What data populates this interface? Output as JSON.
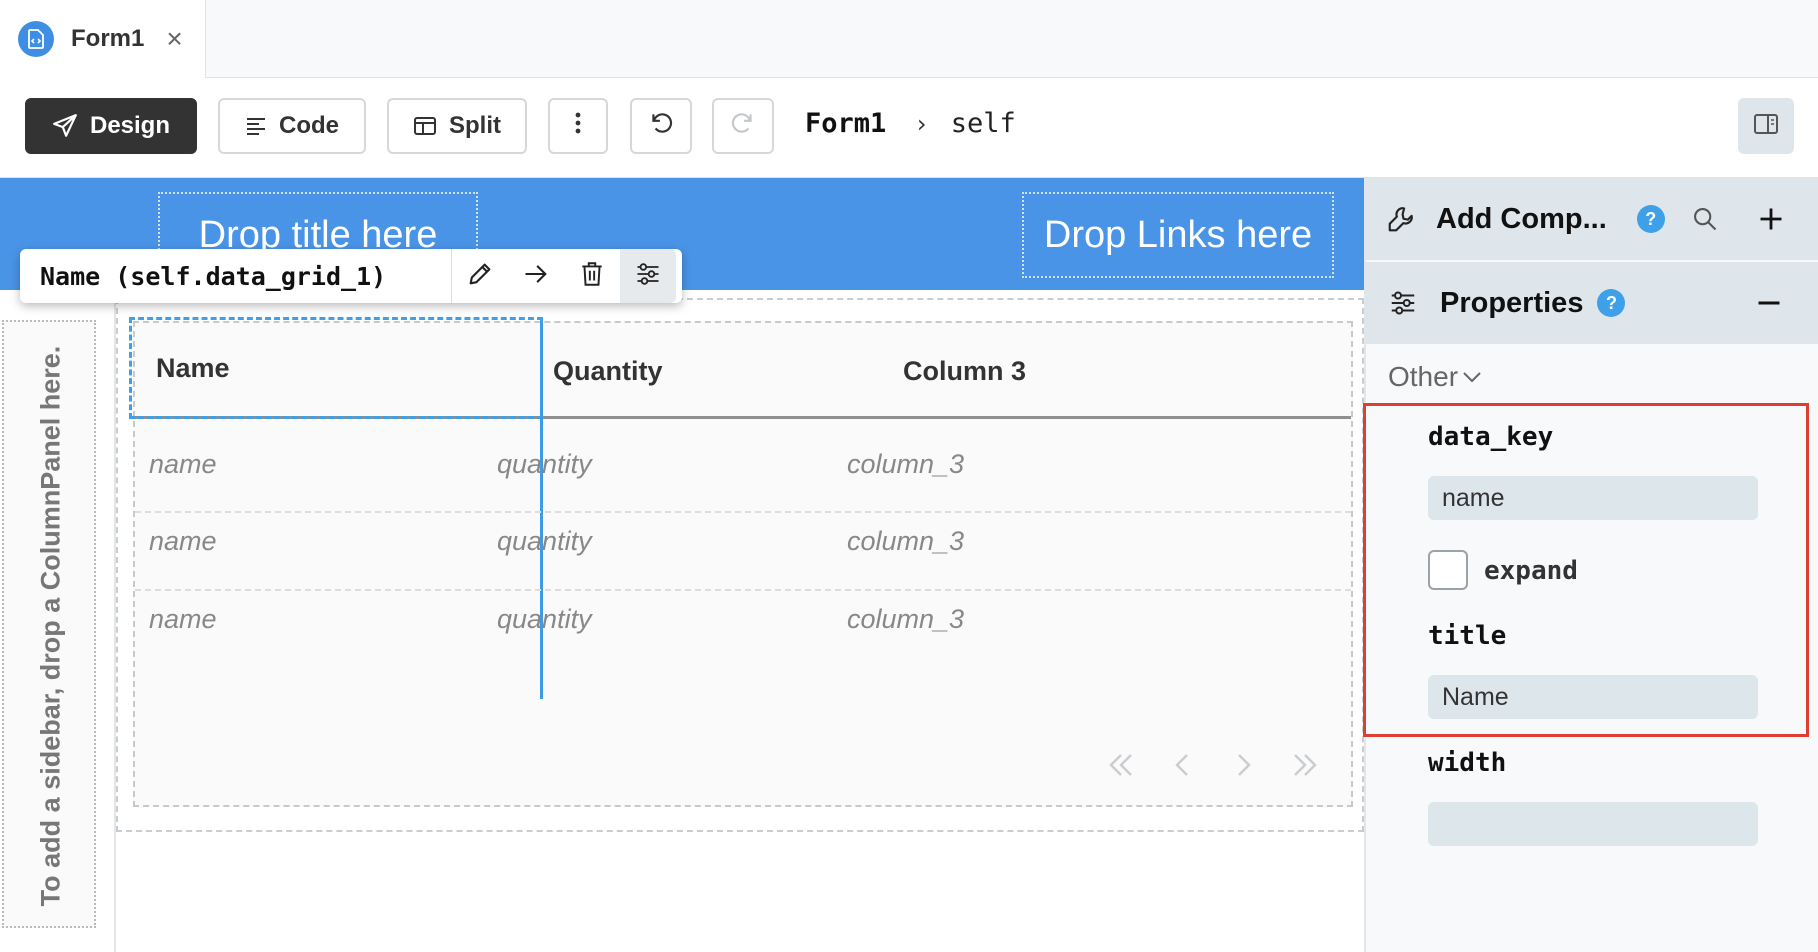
{
  "tabs": [
    {
      "label": "Form1",
      "close": "×"
    }
  ],
  "toolbar": {
    "design_label": "Design",
    "code_label": "Code",
    "split_label": "Split"
  },
  "breadcrumb": {
    "form": "Form1",
    "separator": "›",
    "current": "self"
  },
  "canvas": {
    "drop_title": "Drop title here",
    "drop_links": "Drop Links here",
    "sidebar_hint": "To add a sidebar, drop a ColumnPanel here."
  },
  "component_toolbar": {
    "name": "Name (self.data_grid_1)"
  },
  "data_grid": {
    "columns": [
      "Name",
      "Quantity",
      "Column 3"
    ],
    "rows": [
      [
        "name",
        "quantity",
        "column_3"
      ],
      [
        "name",
        "quantity",
        "column_3"
      ],
      [
        "name",
        "quantity",
        "column_3"
      ]
    ]
  },
  "right_panel": {
    "add_components_title": "Add Comp...",
    "properties_title": "Properties",
    "help_glyph": "?",
    "section_label": "Other",
    "properties": {
      "data_key_label": "data_key",
      "data_key_value": "name",
      "expand_label": "expand",
      "title_label": "title",
      "title_value": "Name",
      "width_label": "width",
      "width_value": ""
    }
  },
  "colors": {
    "accent": "#4a94e8",
    "selection": "#3ea0e8",
    "highlight_box": "#e03e32",
    "design_button": "#333333"
  },
  "icons": {
    "tab": "form-file-icon",
    "design": "paper-plane-icon",
    "code": "code-lines-icon",
    "split": "split-view-icon",
    "more": "vertical-dots-icon",
    "undo": "undo-icon",
    "redo": "redo-icon",
    "panel": "panel-toggle-icon",
    "edit": "pencil-icon",
    "goto": "arrow-right-icon",
    "delete": "trash-icon",
    "properties": "sliders-icon",
    "add": "wrench-icon",
    "search": "search-icon",
    "plus": "plus-icon",
    "minus": "minus-icon"
  }
}
